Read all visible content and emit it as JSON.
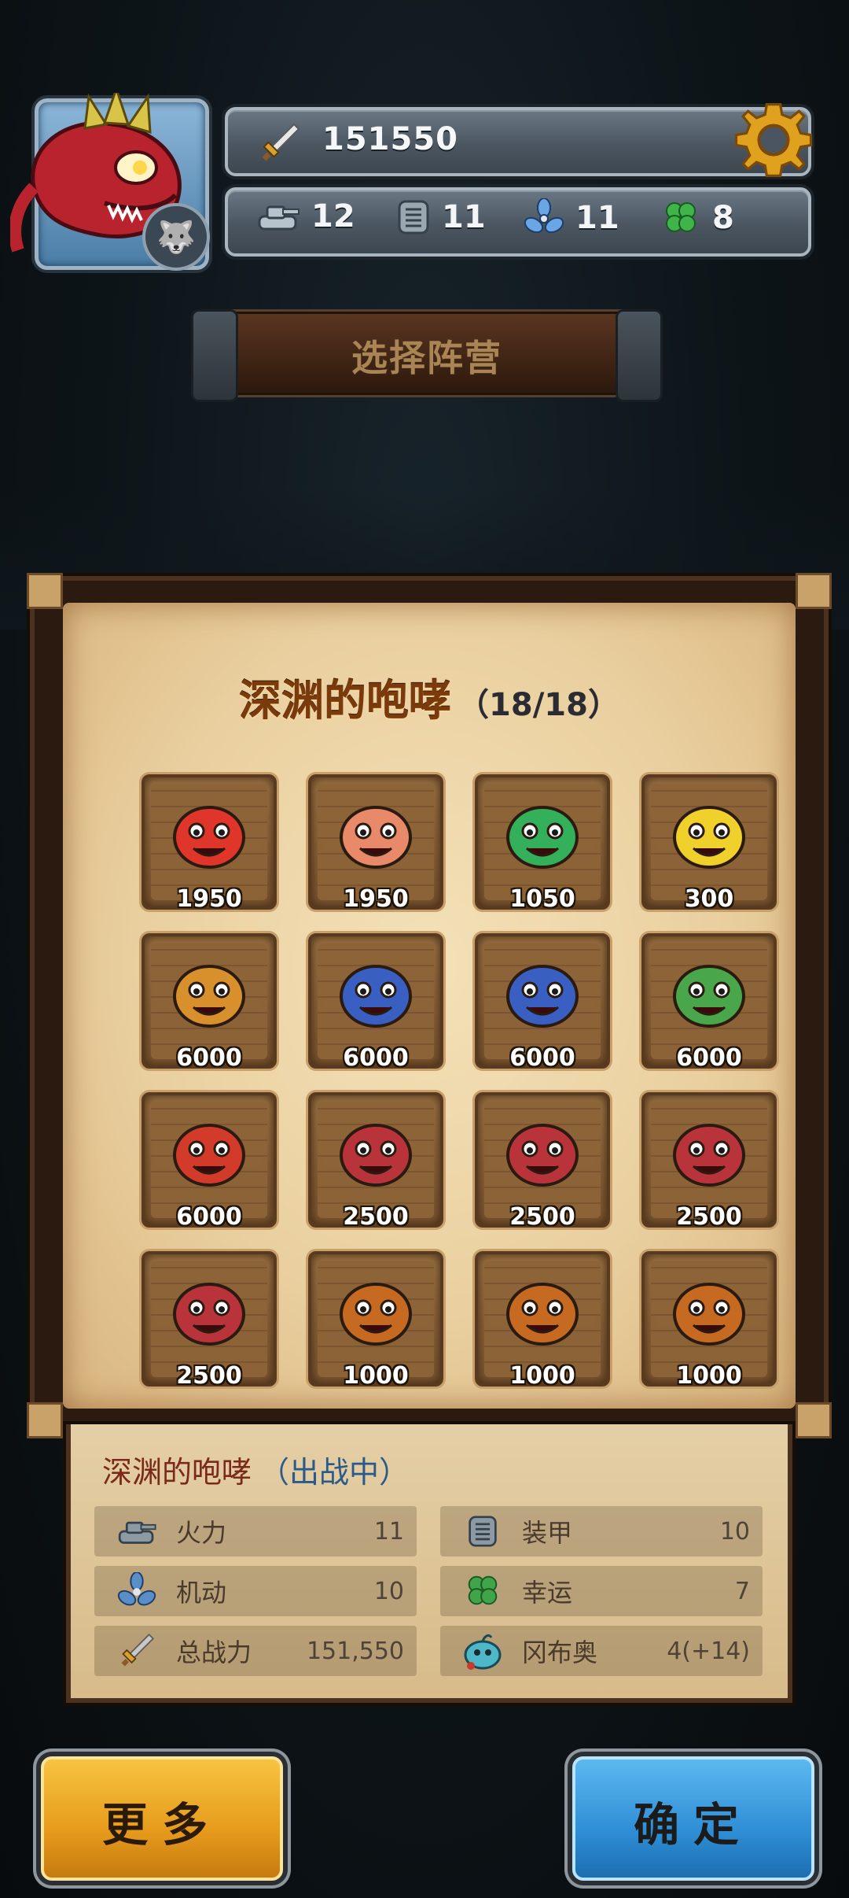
{
  "header": {
    "total_power": "151550",
    "stats": [
      {
        "icon": "tank-icon",
        "value": "12"
      },
      {
        "icon": "armor-icon",
        "value": "11"
      },
      {
        "icon": "propeller-icon",
        "value": "11"
      },
      {
        "icon": "clover-icon",
        "value": "8"
      }
    ]
  },
  "banner": {
    "label": "选择阵营"
  },
  "panel": {
    "title": "深渊的咆哮",
    "count": "（18/18）",
    "units": [
      {
        "price": "1950",
        "color": "#e0352b"
      },
      {
        "price": "1950",
        "color": "#e88a6a"
      },
      {
        "price": "1050",
        "color": "#35b05a"
      },
      {
        "price": "300",
        "color": "#f0d02a"
      },
      {
        "price": "6000",
        "color": "#d8902c"
      },
      {
        "price": "6000",
        "color": "#3a5fc2"
      },
      {
        "price": "6000",
        "color": "#3a5fc2"
      },
      {
        "price": "6000",
        "color": "#4aa64a"
      },
      {
        "price": "6000",
        "color": "#d23a2a"
      },
      {
        "price": "2500",
        "color": "#b8343a"
      },
      {
        "price": "2500",
        "color": "#b8343a"
      },
      {
        "price": "2500",
        "color": "#b8343a"
      },
      {
        "price": "2500",
        "color": "#b8343a"
      },
      {
        "price": "1000",
        "color": "#c66a22"
      },
      {
        "price": "1000",
        "color": "#c66a22"
      },
      {
        "price": "1000",
        "color": "#c66a22"
      }
    ]
  },
  "info": {
    "name": "深渊的咆哮",
    "status": "（出战中）",
    "rows": [
      {
        "icon": "tank-icon",
        "label": "火力",
        "value": "11"
      },
      {
        "icon": "armor-icon",
        "label": "装甲",
        "value": "10"
      },
      {
        "icon": "propeller-icon",
        "label": "机动",
        "value": "10"
      },
      {
        "icon": "clover-icon",
        "label": "幸运",
        "value": "7"
      },
      {
        "icon": "sword-icon",
        "label": "总战力",
        "value": "151,550"
      },
      {
        "icon": "creature-icon",
        "label": "冈布奥",
        "value": "4(+14)"
      }
    ]
  },
  "buttons": {
    "more": "更多",
    "confirm": "确定"
  }
}
